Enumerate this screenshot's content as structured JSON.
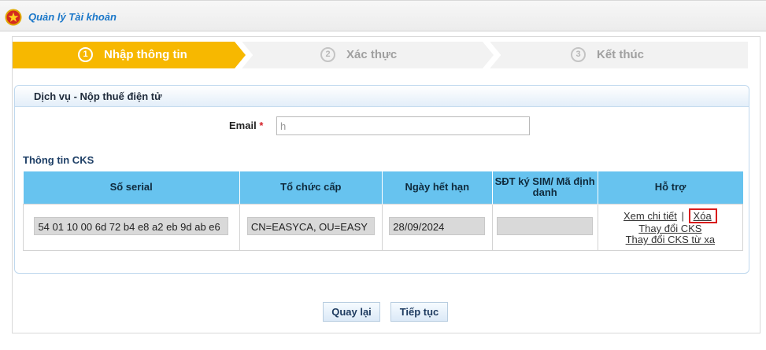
{
  "header": {
    "title": "Quản lý Tài khoản",
    "emblem_icon": "national-emblem-icon"
  },
  "steps": [
    {
      "number": "1",
      "label": "Nhập thông tin",
      "state": "active"
    },
    {
      "number": "2",
      "label": "Xác thực",
      "state": "inactive"
    },
    {
      "number": "3",
      "label": "Kết thúc",
      "state": "inactive"
    }
  ],
  "panel": {
    "title": "Dịch vụ - Nộp thuế điện tử"
  },
  "email": {
    "label": "Email",
    "required_mark": "*",
    "value": "h"
  },
  "cks": {
    "title": "Thông tin CKS",
    "columns": [
      "Số serial",
      "Tổ chức cấp",
      "Ngày hết hạn",
      "SĐT ký SIM/ Mã định danh",
      "Hỗ trợ"
    ],
    "row": {
      "serial": "54 01 10 00 6d 72 b4 e8 a2 eb 9d ab e6",
      "issuer": "CN=EASYCA, OU=EASY",
      "expiry": "28/09/2024",
      "sim_id": "",
      "actions": {
        "view": "Xem chi tiết",
        "separator": "|",
        "delete": "Xóa",
        "change": "Thay đổi CKS",
        "change_remote": "Thay đổi CKS từ xa"
      }
    }
  },
  "buttons": {
    "back": "Quay lại",
    "next": "Tiếp tục"
  },
  "colors": {
    "step_active": "#f7b800",
    "table_header": "#67c3ef",
    "title_blue": "#1a77c9",
    "highlight_red": "#d91c1c"
  }
}
